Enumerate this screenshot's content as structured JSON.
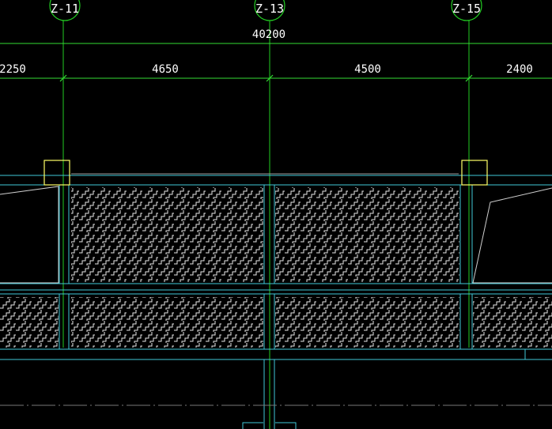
{
  "colors": {
    "background": "#000000",
    "grid_line": "#22cc22",
    "dimension_line": "#33dd33",
    "wall": "#40c8d8",
    "column": "#ffff66",
    "hatch": "#e8e8e8",
    "text": "#ffffff",
    "faint": "#9a9a9a"
  },
  "axes": [
    {
      "label": "Z-11"
    },
    {
      "label": "Z-13"
    },
    {
      "label": "Z-15"
    }
  ],
  "dimensions": {
    "total": "40200",
    "segments": [
      "2250",
      "4650",
      "4500",
      "2400"
    ]
  }
}
